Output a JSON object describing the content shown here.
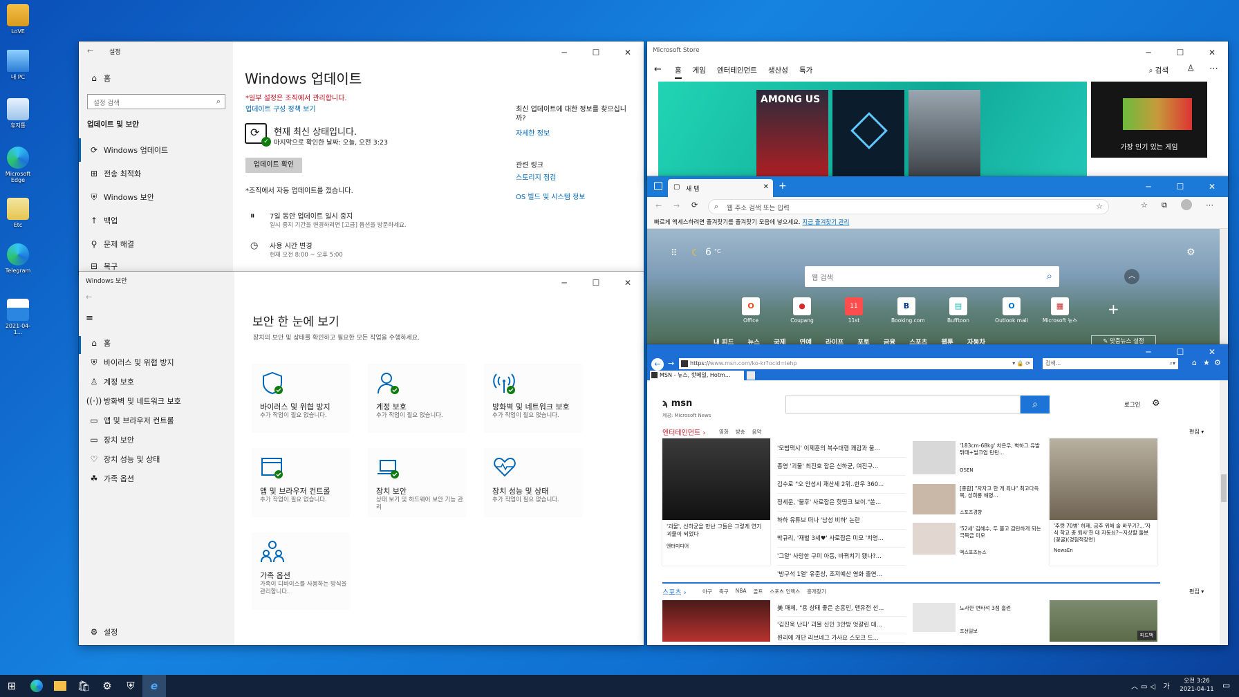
{
  "desktop": {
    "icons": [
      "LoVE",
      "내 PC",
      "휴지통",
      "Microsoft Edge",
      "Etc",
      "Telegram",
      "2021-04-1..."
    ]
  },
  "settings": {
    "title": "설정",
    "home": "홈",
    "search_placeholder": "설정 검색",
    "section": "업데이트 및 보안",
    "nav": [
      "Windows 업데이트",
      "전송 최적화",
      "Windows 보안",
      "백업",
      "문제 해결",
      "복구"
    ],
    "page_title": "Windows 업데이트",
    "managed": "*일부 설정은 조직에서 관리합니다.",
    "policy_link": "업데이트 구성 정책 보기",
    "status_title": "현재 최신 상태입니다.",
    "status_sub": "마지막으로 확인한 날짜: 오늘, 오전 3:23",
    "check_button": "업데이트 확인",
    "org_note": "*조직에서 자동 업데이트를 껐습니다.",
    "pause_title": "7일 동안 업데이트 일시 중지",
    "pause_sub": "일시 중지 기간을 변경하려면 [고급] 옵션을 방문하세요.",
    "hours_title": "사용 시간 변경",
    "hours_sub": "현재 오전 8:00 ~ 오후 5:00",
    "side_q": "최신 업데이트에 대한 정보를 찾으십니까?",
    "side_more": "자세한 정보",
    "related": "관련 링크",
    "storage": "스토리지 점검",
    "os_info": "OS 빌드 및 시스템 정보"
  },
  "security": {
    "title": "Windows 보안",
    "nav": [
      "홈",
      "바이러스 및 위협 방지",
      "계정 보호",
      "방화벽 및 네트워크 보호",
      "앱 및 브라우저 컨트롤",
      "장치 보안",
      "장치 성능 및 상태",
      "가족 옵션"
    ],
    "settings": "설정",
    "heading": "보안 한 눈에 보기",
    "sub": "장치의 보안 및 상태를 확인하고 필요한 모든 작업을 수행하세요.",
    "tiles": [
      {
        "t": "바이러스 및 위협 방지",
        "s": "추가 작업이 필요 없습니다."
      },
      {
        "t": "계정 보호",
        "s": "추가 작업이 필요 없습니다."
      },
      {
        "t": "방화벽 및 네트워크 보호",
        "s": "추가 작업이 필요 없습니다."
      },
      {
        "t": "앱 및 브라우저 컨트롤",
        "s": "추가 작업이 필요 없습니다."
      },
      {
        "t": "장치 보안",
        "s": "상태 보기 및 하드웨어 보안 기능 관리"
      },
      {
        "t": "장치 성능 및 상태",
        "s": "추가 작업이 필요 없습니다."
      },
      {
        "t": "가족 옵션",
        "s": "가족이 디바이스를 사용하는 방식을 관리합니다."
      }
    ]
  },
  "store": {
    "title": "Microsoft Store",
    "tabs": [
      "홈",
      "게임",
      "엔터테인먼트",
      "생산성",
      "특가"
    ],
    "search": "검색",
    "among": "AMONG US",
    "popular": "가장 인기 있는 게임"
  },
  "edge": {
    "tab": "새 탭",
    "address_placeholder": "웹 주소 검색 또는 입력",
    "fav_msg": "빠르게 액세스하려면 즐겨찾기를 즐겨찾기 모음에 넣으세요.",
    "fav_link": "지금 즐겨찾기 관리",
    "weather": "6",
    "weather_unit": "°C",
    "web_search": "웹 검색",
    "tiles": [
      "Office",
      "Coupang",
      "11st",
      "Booking.com",
      "Bufftoon",
      "Outlook mail",
      "Microsoft 뉴스"
    ],
    "news_tabs": [
      "내 피드",
      "뉴스",
      "국제",
      "연예",
      "라이프",
      "포토",
      "금융",
      "스포츠",
      "웹툰",
      "자동차"
    ],
    "news_settings": "맞춤뉴스 설정"
  },
  "ie": {
    "url_https": "https://",
    "url": "www.msn.com/ko-kr?ocid=iehp",
    "search_placeholder": "검색...",
    "tab": "MSN - 뉴스, 핫메일, Hotm...",
    "msn": "msn",
    "msn_sub": "제공: Microsoft News",
    "login": "로그인",
    "ent_title": "엔터테인먼트",
    "ent_subs": [
      "영화",
      "방송",
      "음악"
    ],
    "edit": "편집",
    "main_caption": "'괴물', 신하균을 만난 그들은 그렇게 연기 괴물이 되었다",
    "main_source": "엔터미디어",
    "headlines": [
      "'모범택시' 이제훈의 복수대행 쾌감과 불...",
      "종영 '괴물' 최진호 잡은 신하균, 여진구...",
      "김수로 \"오 안성시 재산세 2위..한우 360...",
      "정세운, '불후' 사로잡은 핫띵크 보이.\"쏟...",
      "하하 유튜브 떠나 '남성 비하' 논란",
      "박규리, '재벌 3세♥' 사로잡은 미모 '치명...",
      "'그알' 사망한 구미 아동, 바뀌치기 됐나?...",
      "'방구석 1열' 유준상, 조저예산 영화 출연..."
    ],
    "side_news": [
      {
        "t": "'183cm-68kg' 차은우, 벽하그 유발 튀태+벌크업 탄탄...",
        "s": "OSEN"
      },
      {
        "t": "[종합] \"자자고 한 게 죄냐\" 최고다윽목, 성희롱 해명...",
        "s": "스포츠경향"
      },
      {
        "t": "'52세' 김혜수, 두 볼고 감탄하게 되는 극복급 미모",
        "s": "엑스포츠뉴스"
      }
    ],
    "right_caption": "'주량 70병' 허재, 금주 위해 술 바꾸기?...'자식 학교 총 퇴사'한 대 자동쇠?~지상할 돌분(꽃귤)(경험적장면)",
    "right_source": "NewsEn",
    "sports_title": "스포츠",
    "sports_subs": [
      "야구",
      "축구",
      "NBA",
      "골프",
      "스포츠 인맥스",
      "흥개찾기"
    ],
    "sports_headlines": [
      "美 매체, \"용 상태 좋은 손흥민, 맨유전 선...",
      "'김진욱 난타' 괴물 신인 3안방 엇갈린 데...",
      "원리에 개단 리브네그 가사요 스모크 드..."
    ],
    "sports_side": "노사한 연타석 3점 홈런",
    "sports_source": "조선일보",
    "feed": "피드백"
  },
  "taskbar": {
    "time": "오전 3:26",
    "date": "2021-04-11"
  }
}
